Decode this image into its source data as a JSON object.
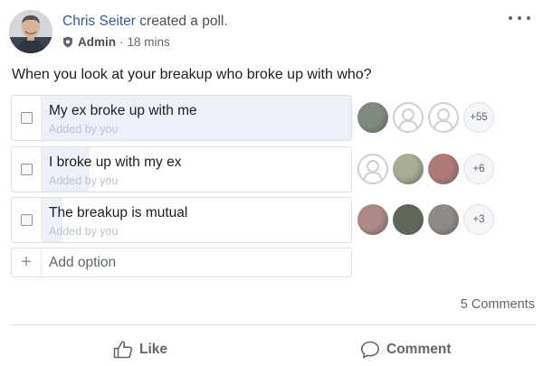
{
  "post": {
    "author_name": "Chris Seiter",
    "action_text": "created a poll.",
    "role": "Admin",
    "separator": "·",
    "timestamp": "18 mins",
    "more_icon": "more-horizontal-icon",
    "role_icon": "shield-icon"
  },
  "poll": {
    "question": "When you look at your breakup who broke up with who?",
    "options": [
      {
        "label": "My ex broke up with me",
        "added_by": "Added by you",
        "vote_share": 1.0,
        "extra_voters": "+55",
        "voter_colors": [
          "#7f8a7c",
          "blank",
          "blank"
        ]
      },
      {
        "label": "I broke up with my ex",
        "added_by": "Added by you",
        "vote_share": 0.23,
        "extra_voters": "+6",
        "voter_colors": [
          "blank",
          "#a7ad92",
          "#b07a78"
        ]
      },
      {
        "label": "The breakup is mutual",
        "added_by": "Added by you",
        "vote_share": 0.15,
        "extra_voters": "+3",
        "voter_colors": [
          "#ad8a86",
          "#5f6658",
          "#8f8a86"
        ]
      }
    ],
    "add_option_placeholder": "Add option"
  },
  "footer": {
    "comments_count": "5 Comments",
    "like_label": "Like",
    "comment_label": "Comment"
  },
  "colors": {
    "link": "#385898",
    "poll_fill": "#ecf0f7",
    "secondary_text": "#606770"
  }
}
